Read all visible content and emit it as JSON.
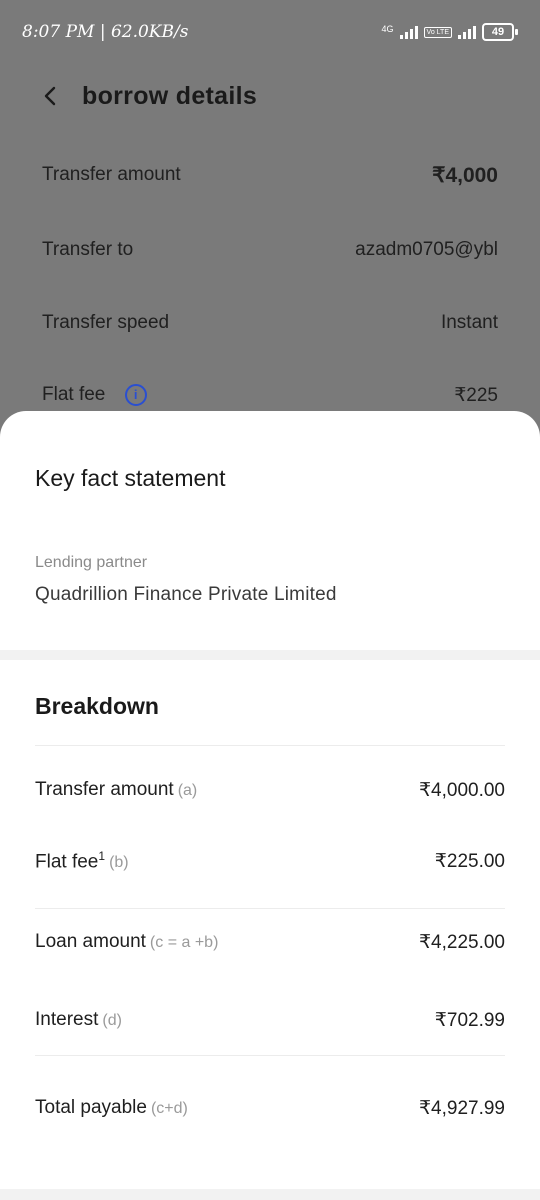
{
  "status_bar": {
    "time_speed": "8:07 PM | 62.0KB/s",
    "network_4g": "4G",
    "volte": "Vo LTE",
    "battery": "49"
  },
  "header": {
    "title": "borrow details"
  },
  "details": {
    "transfer_amount_label": "Transfer amount",
    "transfer_amount_value": "₹4,000",
    "transfer_to_label": "Transfer to",
    "transfer_to_value": "azadm0705@ybl",
    "transfer_speed_label": "Transfer speed",
    "transfer_speed_value": "Instant",
    "flat_fee_label": "Flat fee",
    "flat_fee_value": "₹225",
    "info_glyph": "i"
  },
  "sheet": {
    "title": "Key fact statement",
    "partner_label": "Lending partner",
    "partner_name": "Quadrillion Finance Private Limited",
    "breakdown_title": "Breakdown",
    "rows": [
      {
        "label": "Transfer amount",
        "sup": "",
        "hint": "(a)",
        "value": "₹4,000.00"
      },
      {
        "label": "Flat fee",
        "sup": "1",
        "hint": "(b)",
        "value": "₹225.00"
      },
      {
        "label": "Loan amount",
        "sup": "",
        "hint": "(c = a +b)",
        "value": "₹4,225.00"
      },
      {
        "label": "Interest",
        "sup": "",
        "hint": "(d)",
        "value": "₹702.99"
      },
      {
        "label": "Total payable",
        "sup": "",
        "hint": "(c+d)",
        "value": "₹4,927.99"
      }
    ]
  }
}
